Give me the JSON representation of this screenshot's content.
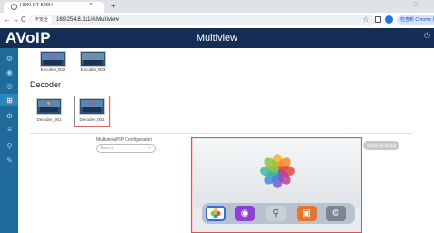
{
  "browser": {
    "tab_title": "HDN-CT-500H",
    "tab_close": "×",
    "new_tab": "+",
    "back": "←",
    "forward": "→",
    "reload": "C",
    "insecure_label": "不安全",
    "url": "169.254.8.111/#/Multiview",
    "window_controls": "–  □",
    "chrome_pill": "检查新 Chrome 版本"
  },
  "header": {
    "logo_a": "A",
    "logo_vo": "Vo",
    "logo_ip": "IP",
    "title": "Multiview",
    "logout_icon": "logout-icon"
  },
  "sidebar": {
    "icons": [
      "gear-icon",
      "settings-icon",
      "eye-icon",
      "grid-icon",
      "sliders-icon",
      "list-icon",
      "tools-icon",
      "wrench-icon"
    ]
  },
  "encoders": [
    {
      "label": "Encoder_002"
    },
    {
      "label": "Encoder_003"
    }
  ],
  "decoder_section": {
    "title": "Decoder",
    "items": [
      {
        "label": "Decoder_001"
      },
      {
        "label": "Decoder_002",
        "selected": true
      }
    ]
  },
  "config": {
    "label": "Multiview/PIP Configuration",
    "select_placeholder": "Select",
    "switch_button": "Switch to Matrix"
  },
  "preview": {
    "dock_apps": [
      "photos-icon",
      "podcasts-icon",
      "search-icon",
      "screen-icon",
      "settings-icon"
    ]
  },
  "colors": {
    "header": "#152e56",
    "sidebar": "#1f6b9c",
    "selection": "#e05050"
  }
}
